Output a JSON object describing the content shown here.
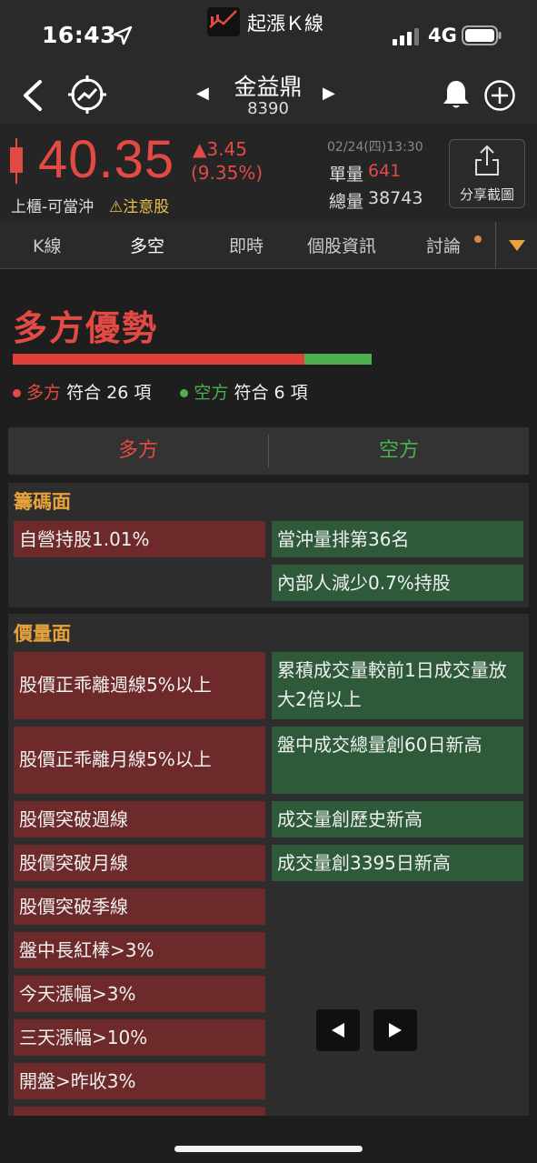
{
  "status_bar": {
    "time": "16:43",
    "app_name": "起漲Ｋ線",
    "network": "4G"
  },
  "header": {
    "stock_name": "金益鼎",
    "stock_code": "8390",
    "prev_label": "◀",
    "next_label": "▶"
  },
  "quote": {
    "price": "40.35",
    "change": "▲3.45",
    "change_pct": "(9.35%)",
    "market_tag": "上櫃-可當沖",
    "warning_tag": "⚠注意股",
    "timestamp": "02/24(四)13:30",
    "volume_label": "單量",
    "volume": "641",
    "total_label": "總量",
    "total": "38743",
    "share_label": "分享截圖"
  },
  "tabs": [
    "K線",
    "多空",
    "即時",
    "個股資訊",
    "討論"
  ],
  "summary": {
    "verdict": "多方優勢",
    "bull_label": "多方",
    "bull_count_text": "符合 26 項",
    "bear_label": "空方",
    "bear_count_text": "符合 6 項",
    "bull_count": 26,
    "bear_count": 6
  },
  "columns": {
    "bull": "多方",
    "bear": "空方"
  },
  "sections": [
    {
      "title": "籌碼面",
      "bull": [
        "自營持股1.01%"
      ],
      "bear": [
        "當沖量排第36名",
        "內部人減少0.7%持股"
      ]
    },
    {
      "title": "價量面",
      "bull": [
        "股價正乖離週線5%以上",
        "股價正乖離月線5%以上",
        "股價突破週線",
        "股價突破月線",
        "股價突破季線",
        "盤中長紅棒>3%",
        "今天漲幅>3%",
        "三天漲幅>10%",
        "開盤>昨收3%"
      ],
      "bear": [
        "累積成交量較前1日成交量放大2倍以上",
        "盤中成交總量創60日新高",
        "成交量創歷史新高",
        "成交量創3395日新高"
      ]
    }
  ],
  "colors": {
    "up": "#e34a43",
    "down": "#4bb04f",
    "accent": "#e8a23a",
    "bg": "#1e1e1e"
  }
}
